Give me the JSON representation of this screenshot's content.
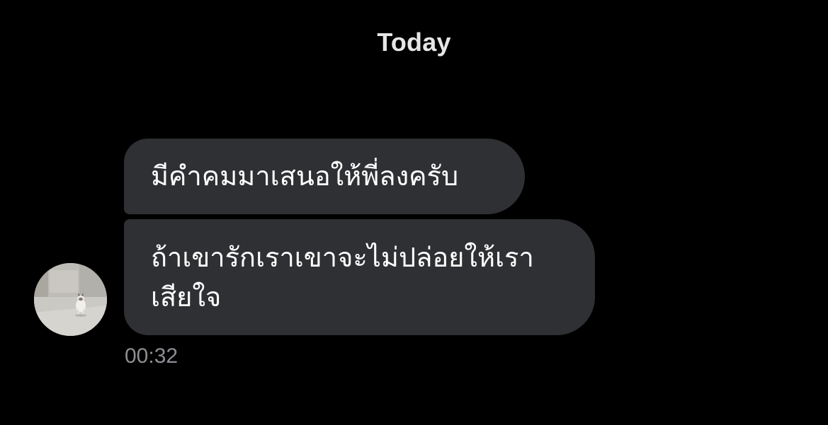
{
  "date_header": "Today",
  "messages": [
    {
      "text": "มีคำคมมาเสนอให้พี่ลงครับ"
    },
    {
      "text": "ถ้าเขารักเราเขาจะไม่ปล่อยให้เรา เสียใจ"
    }
  ],
  "timestamp": "00:32",
  "avatar": {
    "icon": "cat-photo-avatar"
  },
  "colors": {
    "background": "#000000",
    "bubble": "#2f3033",
    "text": "#ffffff",
    "timestamp": "#8e8e93"
  }
}
